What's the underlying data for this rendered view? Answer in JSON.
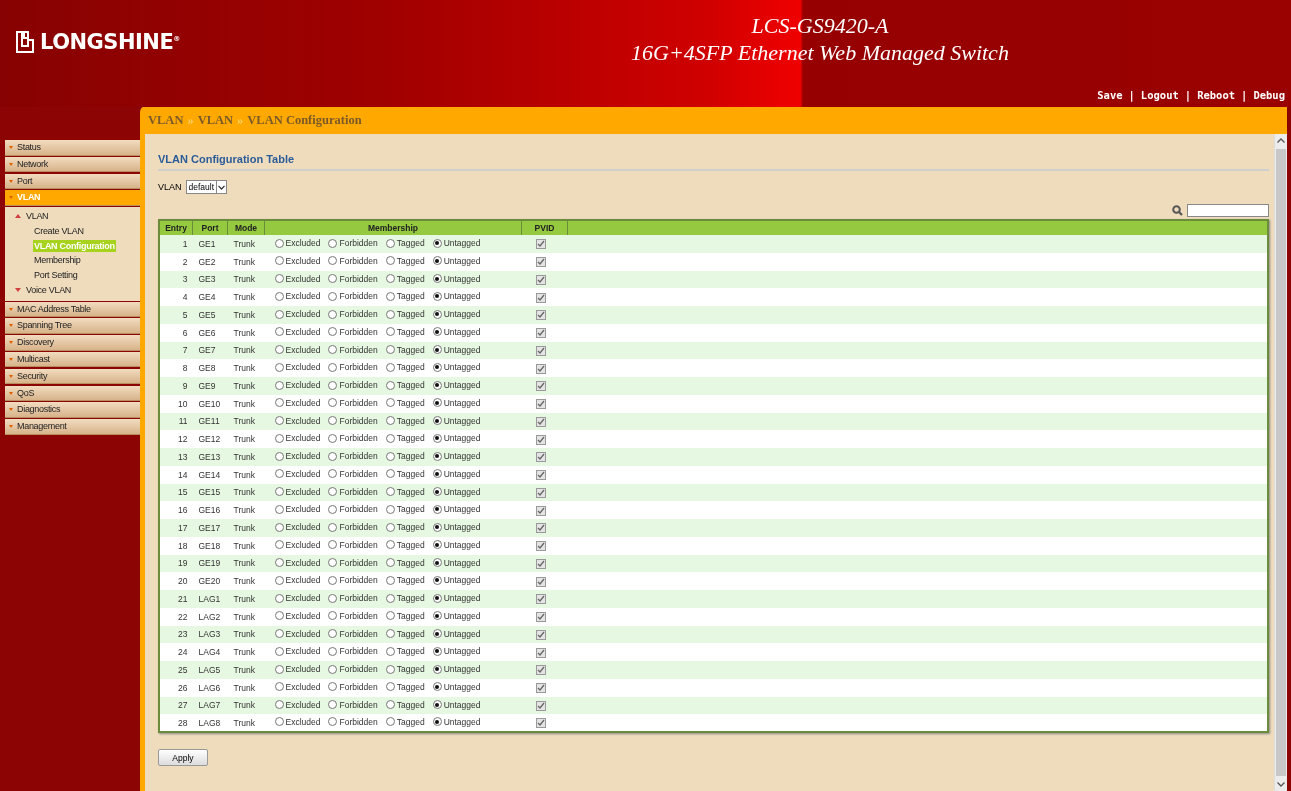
{
  "header": {
    "logo": {
      "text": "LONGSHINE",
      "mark": "®"
    },
    "title": [
      "LCS-GS9420-A",
      "16G+4SFP Ethernet Web Managed Switch"
    ],
    "links": [
      {
        "label": "Save"
      },
      {
        "label": "Logout"
      },
      {
        "label": "Reboot"
      },
      {
        "label": "Debug"
      }
    ],
    "separator": "|"
  },
  "breadcrumb": {
    "items": [
      "VLAN",
      "VLAN",
      "VLAN Configuration"
    ],
    "separator": "»"
  },
  "sidebar": {
    "items": [
      {
        "label": "Status",
        "selected": false
      },
      {
        "label": "Network",
        "selected": false
      },
      {
        "label": "Port",
        "selected": false
      },
      {
        "label": "VLAN",
        "selected": true,
        "children": [
          {
            "label": "VLAN",
            "expanded": true,
            "children": [
              {
                "label": "Create VLAN",
                "selected": false
              },
              {
                "label": "VLAN Configuration",
                "selected": true
              },
              {
                "label": "Membership",
                "selected": false
              },
              {
                "label": "Port Setting",
                "selected": false
              }
            ]
          },
          {
            "label": "Voice VLAN",
            "expanded": false
          }
        ]
      },
      {
        "label": "MAC Address Table",
        "selected": false
      },
      {
        "label": "Spanning Tree",
        "selected": false
      },
      {
        "label": "Discovery",
        "selected": false
      },
      {
        "label": "Multicast",
        "selected": false
      },
      {
        "label": "Security",
        "selected": false
      },
      {
        "label": "QoS",
        "selected": false
      },
      {
        "label": "Diagnostics",
        "selected": false
      },
      {
        "label": "Management",
        "selected": false
      }
    ]
  },
  "content": {
    "title": "VLAN Configuration Table",
    "vlan_label": "VLAN",
    "vlan_value": "default",
    "table": {
      "columns": [
        "Entry",
        "Port",
        "Mode",
        "Membership",
        "PVID"
      ],
      "rows": [
        {
          "entry": "1",
          "port": "GE1",
          "mode": "Trunk",
          "membership": [
            {
              "label": "Excluded",
              "selected": false
            },
            {
              "label": "Forbidden",
              "selected": false
            },
            {
              "label": "Tagged",
              "selected": false
            },
            {
              "label": "Untagged",
              "selected": true
            }
          ],
          "pvid": true
        },
        {
          "entry": "2",
          "port": "GE2",
          "mode": "Trunk",
          "membership": [
            {
              "label": "Excluded",
              "selected": false
            },
            {
              "label": "Forbidden",
              "selected": false
            },
            {
              "label": "Tagged",
              "selected": false
            },
            {
              "label": "Untagged",
              "selected": true
            }
          ],
          "pvid": true
        },
        {
          "entry": "3",
          "port": "GE3",
          "mode": "Trunk",
          "membership": [
            {
              "label": "Excluded",
              "selected": false
            },
            {
              "label": "Forbidden",
              "selected": false
            },
            {
              "label": "Tagged",
              "selected": false
            },
            {
              "label": "Untagged",
              "selected": true
            }
          ],
          "pvid": true
        },
        {
          "entry": "4",
          "port": "GE4",
          "mode": "Trunk",
          "membership": [
            {
              "label": "Excluded",
              "selected": false
            },
            {
              "label": "Forbidden",
              "selected": false
            },
            {
              "label": "Tagged",
              "selected": false
            },
            {
              "label": "Untagged",
              "selected": true
            }
          ],
          "pvid": true
        },
        {
          "entry": "5",
          "port": "GE5",
          "mode": "Trunk",
          "membership": [
            {
              "label": "Excluded",
              "selected": false
            },
            {
              "label": "Forbidden",
              "selected": false
            },
            {
              "label": "Tagged",
              "selected": false
            },
            {
              "label": "Untagged",
              "selected": true
            }
          ],
          "pvid": true
        },
        {
          "entry": "6",
          "port": "GE6",
          "mode": "Trunk",
          "membership": [
            {
              "label": "Excluded",
              "selected": false
            },
            {
              "label": "Forbidden",
              "selected": false
            },
            {
              "label": "Tagged",
              "selected": false
            },
            {
              "label": "Untagged",
              "selected": true
            }
          ],
          "pvid": true
        },
        {
          "entry": "7",
          "port": "GE7",
          "mode": "Trunk",
          "membership": [
            {
              "label": "Excluded",
              "selected": false
            },
            {
              "label": "Forbidden",
              "selected": false
            },
            {
              "label": "Tagged",
              "selected": false
            },
            {
              "label": "Untagged",
              "selected": true
            }
          ],
          "pvid": true
        },
        {
          "entry": "8",
          "port": "GE8",
          "mode": "Trunk",
          "membership": [
            {
              "label": "Excluded",
              "selected": false
            },
            {
              "label": "Forbidden",
              "selected": false
            },
            {
              "label": "Tagged",
              "selected": false
            },
            {
              "label": "Untagged",
              "selected": true
            }
          ],
          "pvid": true
        },
        {
          "entry": "9",
          "port": "GE9",
          "mode": "Trunk",
          "membership": [
            {
              "label": "Excluded",
              "selected": false
            },
            {
              "label": "Forbidden",
              "selected": false
            },
            {
              "label": "Tagged",
              "selected": false
            },
            {
              "label": "Untagged",
              "selected": true
            }
          ],
          "pvid": true
        },
        {
          "entry": "10",
          "port": "GE10",
          "mode": "Trunk",
          "membership": [
            {
              "label": "Excluded",
              "selected": false
            },
            {
              "label": "Forbidden",
              "selected": false
            },
            {
              "label": "Tagged",
              "selected": false
            },
            {
              "label": "Untagged",
              "selected": true
            }
          ],
          "pvid": true
        },
        {
          "entry": "11",
          "port": "GE11",
          "mode": "Trunk",
          "membership": [
            {
              "label": "Excluded",
              "selected": false
            },
            {
              "label": "Forbidden",
              "selected": false
            },
            {
              "label": "Tagged",
              "selected": false
            },
            {
              "label": "Untagged",
              "selected": true
            }
          ],
          "pvid": true
        },
        {
          "entry": "12",
          "port": "GE12",
          "mode": "Trunk",
          "membership": [
            {
              "label": "Excluded",
              "selected": false
            },
            {
              "label": "Forbidden",
              "selected": false
            },
            {
              "label": "Tagged",
              "selected": false
            },
            {
              "label": "Untagged",
              "selected": true
            }
          ],
          "pvid": true
        },
        {
          "entry": "13",
          "port": "GE13",
          "mode": "Trunk",
          "membership": [
            {
              "label": "Excluded",
              "selected": false
            },
            {
              "label": "Forbidden",
              "selected": false
            },
            {
              "label": "Tagged",
              "selected": false
            },
            {
              "label": "Untagged",
              "selected": true
            }
          ],
          "pvid": true
        },
        {
          "entry": "14",
          "port": "GE14",
          "mode": "Trunk",
          "membership": [
            {
              "label": "Excluded",
              "selected": false
            },
            {
              "label": "Forbidden",
              "selected": false
            },
            {
              "label": "Tagged",
              "selected": false
            },
            {
              "label": "Untagged",
              "selected": true
            }
          ],
          "pvid": true
        },
        {
          "entry": "15",
          "port": "GE15",
          "mode": "Trunk",
          "membership": [
            {
              "label": "Excluded",
              "selected": false
            },
            {
              "label": "Forbidden",
              "selected": false
            },
            {
              "label": "Tagged",
              "selected": false
            },
            {
              "label": "Untagged",
              "selected": true
            }
          ],
          "pvid": true
        },
        {
          "entry": "16",
          "port": "GE16",
          "mode": "Trunk",
          "membership": [
            {
              "label": "Excluded",
              "selected": false
            },
            {
              "label": "Forbidden",
              "selected": false
            },
            {
              "label": "Tagged",
              "selected": false
            },
            {
              "label": "Untagged",
              "selected": true
            }
          ],
          "pvid": true
        },
        {
          "entry": "17",
          "port": "GE17",
          "mode": "Trunk",
          "membership": [
            {
              "label": "Excluded",
              "selected": false
            },
            {
              "label": "Forbidden",
              "selected": false
            },
            {
              "label": "Tagged",
              "selected": false
            },
            {
              "label": "Untagged",
              "selected": true
            }
          ],
          "pvid": true
        },
        {
          "entry": "18",
          "port": "GE18",
          "mode": "Trunk",
          "membership": [
            {
              "label": "Excluded",
              "selected": false
            },
            {
              "label": "Forbidden",
              "selected": false
            },
            {
              "label": "Tagged",
              "selected": false
            },
            {
              "label": "Untagged",
              "selected": true
            }
          ],
          "pvid": true
        },
        {
          "entry": "19",
          "port": "GE19",
          "mode": "Trunk",
          "membership": [
            {
              "label": "Excluded",
              "selected": false
            },
            {
              "label": "Forbidden",
              "selected": false
            },
            {
              "label": "Tagged",
              "selected": false
            },
            {
              "label": "Untagged",
              "selected": true
            }
          ],
          "pvid": true
        },
        {
          "entry": "20",
          "port": "GE20",
          "mode": "Trunk",
          "membership": [
            {
              "label": "Excluded",
              "selected": false
            },
            {
              "label": "Forbidden",
              "selected": false
            },
            {
              "label": "Tagged",
              "selected": false
            },
            {
              "label": "Untagged",
              "selected": true
            }
          ],
          "pvid": true
        },
        {
          "entry": "21",
          "port": "LAG1",
          "mode": "Trunk",
          "membership": [
            {
              "label": "Excluded",
              "selected": false
            },
            {
              "label": "Forbidden",
              "selected": false
            },
            {
              "label": "Tagged",
              "selected": false
            },
            {
              "label": "Untagged",
              "selected": true
            }
          ],
          "pvid": true
        },
        {
          "entry": "22",
          "port": "LAG2",
          "mode": "Trunk",
          "membership": [
            {
              "label": "Excluded",
              "selected": false
            },
            {
              "label": "Forbidden",
              "selected": false
            },
            {
              "label": "Tagged",
              "selected": false
            },
            {
              "label": "Untagged",
              "selected": true
            }
          ],
          "pvid": true
        },
        {
          "entry": "23",
          "port": "LAG3",
          "mode": "Trunk",
          "membership": [
            {
              "label": "Excluded",
              "selected": false
            },
            {
              "label": "Forbidden",
              "selected": false
            },
            {
              "label": "Tagged",
              "selected": false
            },
            {
              "label": "Untagged",
              "selected": true
            }
          ],
          "pvid": true
        },
        {
          "entry": "24",
          "port": "LAG4",
          "mode": "Trunk",
          "membership": [
            {
              "label": "Excluded",
              "selected": false
            },
            {
              "label": "Forbidden",
              "selected": false
            },
            {
              "label": "Tagged",
              "selected": false
            },
            {
              "label": "Untagged",
              "selected": true
            }
          ],
          "pvid": true
        },
        {
          "entry": "25",
          "port": "LAG5",
          "mode": "Trunk",
          "membership": [
            {
              "label": "Excluded",
              "selected": false
            },
            {
              "label": "Forbidden",
              "selected": false
            },
            {
              "label": "Tagged",
              "selected": false
            },
            {
              "label": "Untagged",
              "selected": true
            }
          ],
          "pvid": true
        },
        {
          "entry": "26",
          "port": "LAG6",
          "mode": "Trunk",
          "membership": [
            {
              "label": "Excluded",
              "selected": false
            },
            {
              "label": "Forbidden",
              "selected": false
            },
            {
              "label": "Tagged",
              "selected": false
            },
            {
              "label": "Untagged",
              "selected": true
            }
          ],
          "pvid": true
        },
        {
          "entry": "27",
          "port": "LAG7",
          "mode": "Trunk",
          "membership": [
            {
              "label": "Excluded",
              "selected": false
            },
            {
              "label": "Forbidden",
              "selected": false
            },
            {
              "label": "Tagged",
              "selected": false
            },
            {
              "label": "Untagged",
              "selected": true
            }
          ],
          "pvid": true
        },
        {
          "entry": "28",
          "port": "LAG8",
          "mode": "Trunk",
          "membership": [
            {
              "label": "Excluded",
              "selected": false
            },
            {
              "label": "Forbidden",
              "selected": false
            },
            {
              "label": "Tagged",
              "selected": false
            },
            {
              "label": "Untagged",
              "selected": true
            }
          ],
          "pvid": true
        }
      ]
    },
    "apply_button": "Apply"
  }
}
